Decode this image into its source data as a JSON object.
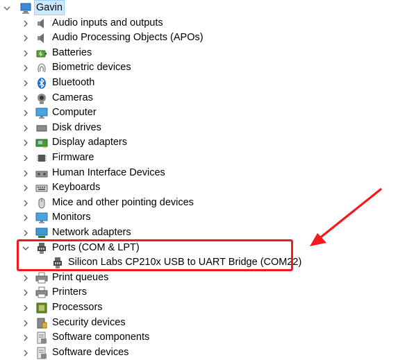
{
  "root": {
    "label": "Gavin",
    "icon": "computer-icon",
    "expanded": true
  },
  "categories": [
    {
      "label": "Audio inputs and outputs",
      "icon": "speaker-icon",
      "expanded": false
    },
    {
      "label": "Audio Processing Objects (APOs)",
      "icon": "speaker-icon",
      "expanded": false
    },
    {
      "label": "Batteries",
      "icon": "battery-icon",
      "expanded": false
    },
    {
      "label": "Biometric devices",
      "icon": "fingerprint-icon",
      "expanded": false
    },
    {
      "label": "Bluetooth",
      "icon": "bluetooth-icon",
      "expanded": false
    },
    {
      "label": "Cameras",
      "icon": "camera-icon",
      "expanded": false
    },
    {
      "label": "Computer",
      "icon": "monitor-icon",
      "expanded": false
    },
    {
      "label": "Disk drives",
      "icon": "disk-drive-icon",
      "expanded": false
    },
    {
      "label": "Display adapters",
      "icon": "display-adapter-icon",
      "expanded": false
    },
    {
      "label": "Firmware",
      "icon": "chip-icon",
      "expanded": false
    },
    {
      "label": "Human Interface Devices",
      "icon": "hid-icon",
      "expanded": false
    },
    {
      "label": "Keyboards",
      "icon": "keyboard-icon",
      "expanded": false
    },
    {
      "label": "Mice and other pointing devices",
      "icon": "mouse-icon",
      "expanded": false
    },
    {
      "label": "Monitors",
      "icon": "monitor-icon",
      "expanded": false
    },
    {
      "label": "Network adapters",
      "icon": "network-icon",
      "expanded": false
    },
    {
      "label": "Ports (COM & LPT)",
      "icon": "port-icon",
      "expanded": true,
      "children": [
        {
          "label": "Silicon Labs CP210x USB to UART Bridge (COM22)",
          "icon": "port-icon"
        }
      ]
    },
    {
      "label": "Print queues",
      "icon": "printer-icon",
      "expanded": false
    },
    {
      "label": "Printers",
      "icon": "printer-icon",
      "expanded": false
    },
    {
      "label": "Processors",
      "icon": "processor-icon",
      "expanded": false
    },
    {
      "label": "Security devices",
      "icon": "security-icon",
      "expanded": false
    },
    {
      "label": "Software components",
      "icon": "software-icon",
      "expanded": false
    },
    {
      "label": "Software devices",
      "icon": "software-icon",
      "expanded": false
    }
  ],
  "colors": {
    "highlight": "#f21a1a",
    "selection": "#cce8ff",
    "chevron": "#5a5a5a"
  }
}
